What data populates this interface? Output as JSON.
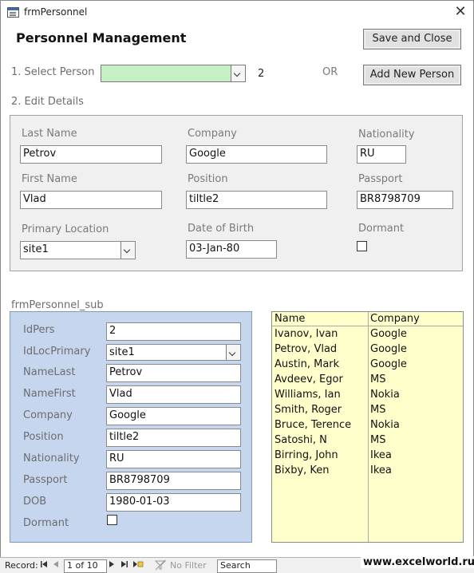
{
  "window": {
    "title": "frmPersonnel",
    "close_glyph": "✕"
  },
  "header": {
    "title": "Personnel Management",
    "save_close_label": "Save and Close"
  },
  "select": {
    "step_label": "1. Select Person",
    "combo_value": "",
    "selected_id": "2",
    "or_label": "OR",
    "add_label": "Add New Person"
  },
  "edit": {
    "step_label": "2. Edit Details",
    "last_name": {
      "label": "Last Name",
      "value": "Petrov"
    },
    "company": {
      "label": "Company",
      "value": "Google"
    },
    "nationality": {
      "label": "Nationality",
      "value": "RU"
    },
    "first_name": {
      "label": "First Name",
      "value": "Vlad"
    },
    "position": {
      "label": "Position",
      "value": "tiltle2"
    },
    "passport": {
      "label": "Passport",
      "value": "BR8798709"
    },
    "primary_location": {
      "label": "Primary Location",
      "value": "site1"
    },
    "dob": {
      "label": "Date of Birth",
      "value": "03-Jan-80"
    },
    "dormant": {
      "label": "Dormant",
      "checked": false
    }
  },
  "subform": {
    "caption": "frmPersonnel_sub",
    "rows": [
      {
        "label": "IdPers",
        "value": "2"
      },
      {
        "label": "IdLocPrimary",
        "value": "site1"
      },
      {
        "label": "NameLast",
        "value": "Petrov"
      },
      {
        "label": "NameFirst",
        "value": "Vlad"
      },
      {
        "label": "Company",
        "value": "Google"
      },
      {
        "label": "Position",
        "value": "tiltle2"
      },
      {
        "label": "Nationality",
        "value": "RU"
      },
      {
        "label": "Passport",
        "value": "BR8798709"
      },
      {
        "label": "DOB",
        "value": "1980-01-03"
      }
    ],
    "dormant_label": "Dormant",
    "dormant_checked": false
  },
  "list": {
    "headers": [
      "Name",
      "Company"
    ],
    "rows": [
      [
        "Ivanov, Ivan",
        "Google"
      ],
      [
        "Petrov, Vlad",
        "Google"
      ],
      [
        "Austin, Mark",
        "Google"
      ],
      [
        "Avdeev, Egor",
        "MS"
      ],
      [
        "Williams, Ian",
        "Nokia"
      ],
      [
        "Smith, Roger",
        "MS"
      ],
      [
        "Bruce, Terence",
        "Nokia"
      ],
      [
        "Satoshi, N",
        "MS"
      ],
      [
        "Birring, John",
        "Ikea"
      ],
      [
        "Bixby, Ken",
        "Ikea"
      ]
    ]
  },
  "navbar": {
    "record_label": "Record:",
    "position": "1 of 10",
    "filter_label": "No Filter",
    "search_placeholder": "Search"
  },
  "watermark": "www.excelworld.ru"
}
